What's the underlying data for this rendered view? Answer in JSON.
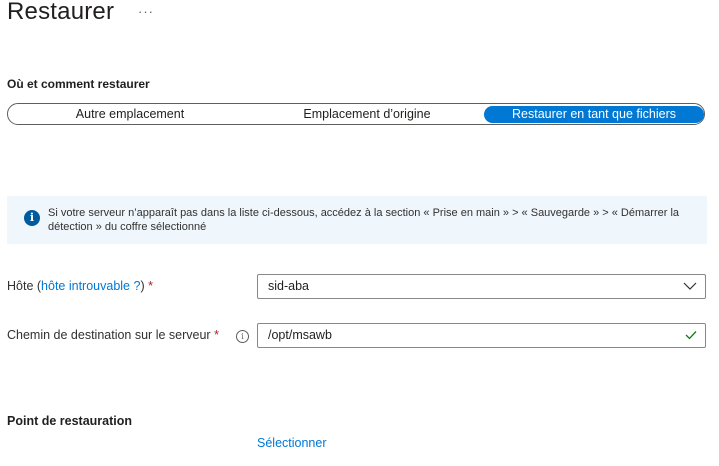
{
  "header": {
    "title": "Restaurer",
    "more_label": "···"
  },
  "where_section": {
    "heading": "Où et comment restaurer",
    "options": [
      {
        "label": "Autre emplacement",
        "selected": false
      },
      {
        "label": "Emplacement d’origine",
        "selected": false
      },
      {
        "label": "Restaurer en tant que fichiers",
        "selected": true
      }
    ]
  },
  "info_banner": {
    "icon": "info-icon",
    "text": "Si votre serveur n’apparaît pas dans la liste ci-dessous, accédez à la section « Prise en main » > « Sauvegarde » > « Démarrer la détection » du coffre sélectionné"
  },
  "host": {
    "label": "Hôte (",
    "link": "hôte introuvable ?",
    "label_suffix": ")",
    "required_mark": "*",
    "value": "sid-aba"
  },
  "destination": {
    "label": "Chemin de destination sur le serveur",
    "required_mark": "*",
    "value": "/opt/msawb",
    "valid": true
  },
  "restore_point": {
    "heading": "Point de restauration",
    "select_link": "Sélectionner"
  },
  "colors": {
    "accent": "#0078d4",
    "required": "#a4262c",
    "info_bg": "#eff6fc",
    "valid": "#107c10"
  }
}
